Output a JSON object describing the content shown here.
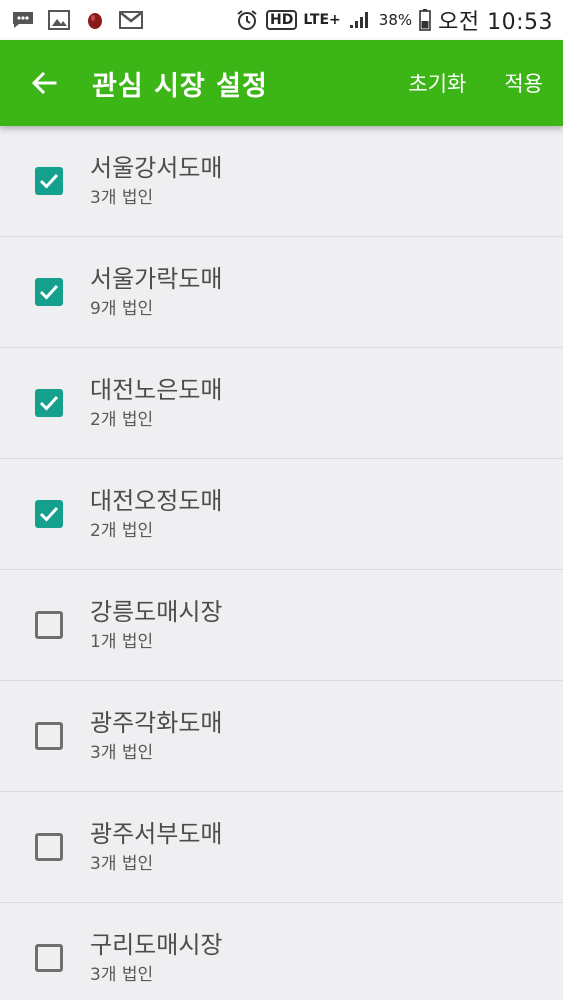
{
  "status_bar": {
    "battery": "38%",
    "time": "오전 10:53",
    "network": "LTE+",
    "hd": "HD"
  },
  "app_bar": {
    "title": "관심 시장 설정",
    "reset_label": "초기화",
    "apply_label": "적용"
  },
  "colors": {
    "app_bar": "#3cb517",
    "checkbox_checked": "#14a08c"
  },
  "markets": [
    {
      "name": "서울강서도매",
      "count": "3개 법인",
      "checked": true
    },
    {
      "name": "서울가락도매",
      "count": "9개 법인",
      "checked": true
    },
    {
      "name": "대전노은도매",
      "count": "2개 법인",
      "checked": true
    },
    {
      "name": "대전오정도매",
      "count": "2개 법인",
      "checked": true
    },
    {
      "name": "강릉도매시장",
      "count": "1개 법인",
      "checked": false
    },
    {
      "name": "광주각화도매",
      "count": "3개 법인",
      "checked": false
    },
    {
      "name": "광주서부도매",
      "count": "3개 법인",
      "checked": false
    },
    {
      "name": "구리도매시장",
      "count": "3개 법인",
      "checked": false
    }
  ]
}
